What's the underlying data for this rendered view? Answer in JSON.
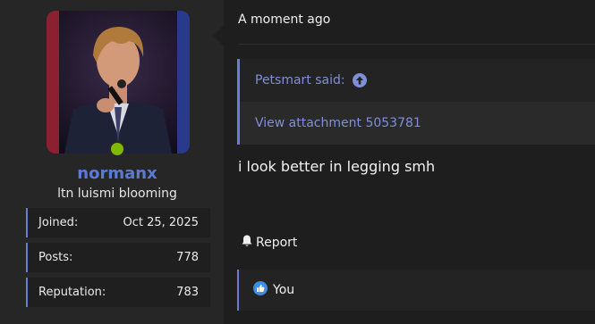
{
  "user": {
    "username": "normanx",
    "title": "ltn luismi blooming",
    "online": true,
    "stats": [
      {
        "label": "Joined:",
        "value": "Oct 25, 2025"
      },
      {
        "label": "Posts:",
        "value": "778"
      },
      {
        "label": "Reputation:",
        "value": "783"
      }
    ]
  },
  "post": {
    "time": "A moment ago",
    "quote": {
      "author_line": "Petsmart said:",
      "attachment": "View attachment 5053781"
    },
    "body": "i look better in legging smh",
    "report_label": "Report",
    "reaction_label": "You"
  },
  "colors": {
    "accent": "#6b7bd6",
    "username": "#5b7ad6",
    "online": "#7fb800",
    "background": "#1e1e1e",
    "panel": "#262626"
  },
  "icons": [
    "arrow-up-circle-icon",
    "bell-icon",
    "like-icon"
  ]
}
